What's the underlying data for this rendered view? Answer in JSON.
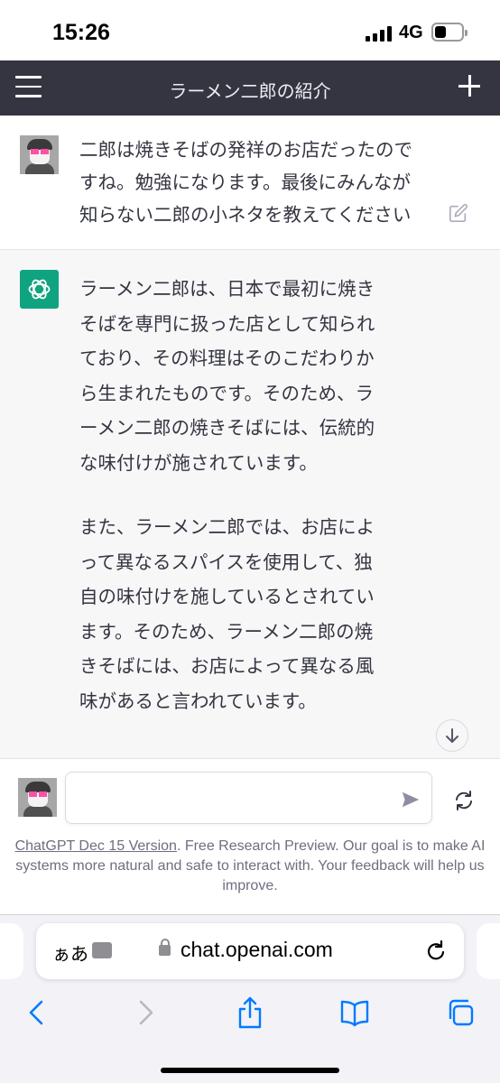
{
  "status_bar": {
    "time": "15:26",
    "network": "4G"
  },
  "header": {
    "title": "ラーメン二郎の紹介"
  },
  "conversation": {
    "user_message": {
      "lines": [
        "二郎は焼きそばの発祥のお店だったので",
        "すね。勉強になります。最後にみんなが",
        "知らない二郎の小ネタを教えてください"
      ]
    },
    "assistant_message": {
      "paragraph1_lines": [
        "ラーメン二郎は、日本で最初に焼き",
        "そばを専門に扱った店として知られ",
        "ており、その料理はそのこだわりか",
        "ら生まれたものです。そのため、ラ",
        "ーメン二郎の焼きそばには、伝統的",
        "な味付けが施されています。"
      ],
      "paragraph2_lines": [
        "また、ラーメン二郎では、お店によ",
        "って異なるスパイスを使用して、独",
        "自の味付けを施しているとされてい",
        "ます。そのため、ラーメン二郎の焼",
        "きそばには、お店によって異なる風",
        "味があると言われています。"
      ]
    }
  },
  "composer": {
    "input_value": "",
    "footer_link": "ChatGPT Dec 15 Version",
    "footer_text": ". Free Research Preview. Our goal is to make AI systems more natural and safe to interact with. Your feedback will help us improve."
  },
  "browser": {
    "aa_label": "ぁあ",
    "url": "chat.openai.com"
  },
  "colors": {
    "header_bg": "#343541",
    "assistant_bg": "#f7f7f8",
    "openai_green": "#10a37f",
    "ios_blue": "#007aff"
  },
  "icons": [
    "menu-icon",
    "plus-icon",
    "edit-icon",
    "openai-logo-icon",
    "arrow-down-icon",
    "send-icon",
    "regenerate-icon",
    "puzzle-icon",
    "lock-icon",
    "reload-icon",
    "back-icon",
    "forward-icon",
    "share-icon",
    "bookmarks-icon",
    "tabs-icon"
  ]
}
